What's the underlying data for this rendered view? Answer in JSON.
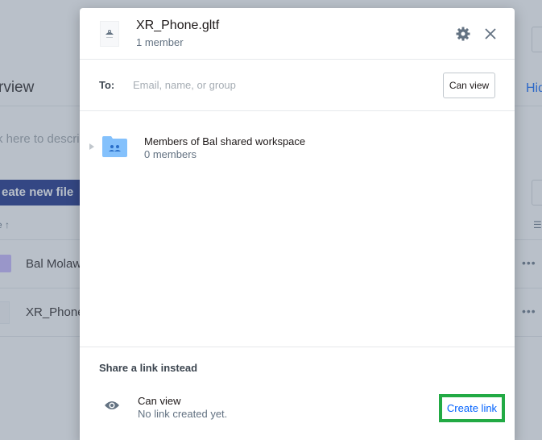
{
  "background": {
    "section_title": "rview",
    "description_placeholder": "k here to descri",
    "create_button_label": "eate new file",
    "sort_label": "e",
    "rows": [
      {
        "name": "Bal Molaw"
      },
      {
        "name": "XR_Phone"
      }
    ],
    "right_link": "Hid",
    "row_menu": "•••"
  },
  "modal": {
    "file_name": "XR_Phone.gltf",
    "member_count": "1 member",
    "icons": {
      "settings": "gear-icon",
      "close": "close-icon",
      "file": "3d-model-icon"
    },
    "to": {
      "label": "To:",
      "placeholder": "Email, name, or group",
      "value": "",
      "permission": "Can view"
    },
    "members": [
      {
        "name": "Members of Bal shared workspace",
        "count": "0 members",
        "icon": "shared-folder-icon"
      }
    ],
    "share_link": {
      "title": "Share a link instead",
      "permission": "Can view",
      "status": "No link created yet.",
      "action": "Create link",
      "icon": "eye-icon"
    }
  },
  "colors": {
    "accent": "#0061fe",
    "highlight": "#22aa44",
    "folder": "#84c1fc"
  }
}
